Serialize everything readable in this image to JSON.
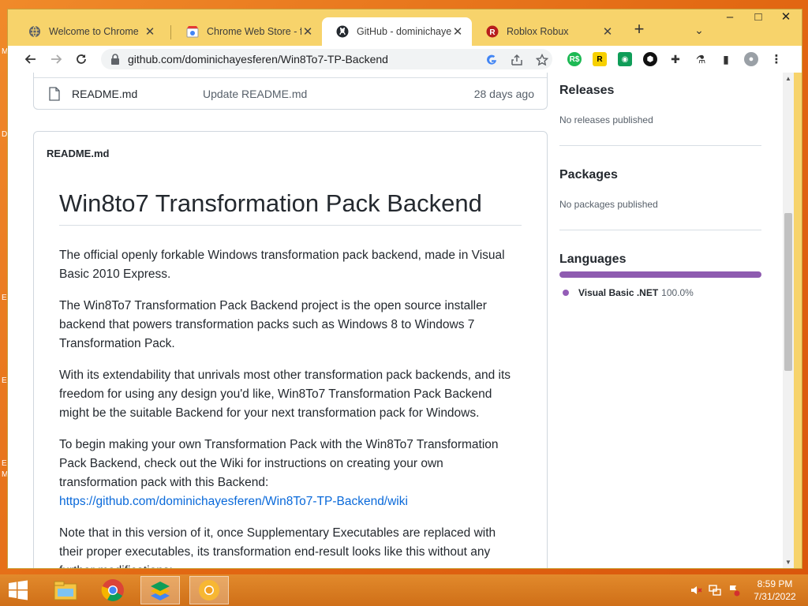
{
  "desktop": {
    "edge_letters": [
      "M",
      "D",
      "E",
      "E",
      "E",
      "M"
    ]
  },
  "tabs": [
    {
      "title": "Welcome to Chrome",
      "icon": "chrome-globe-icon"
    },
    {
      "title": "Chrome Web Store - fre",
      "icon": "webstore-icon"
    },
    {
      "title": "GitHub - dominichayesf",
      "icon": "github-icon",
      "active": true
    },
    {
      "title": "Roblox Robux",
      "icon": "roblox-icon"
    }
  ],
  "tabstrip": {
    "new_tab": "+",
    "tab_search": "⌄"
  },
  "window_controls": {
    "minimize": "–",
    "maximize": "□",
    "close": "✕"
  },
  "address_bar": {
    "url": "github.com/dominichayesferen/Win8To7-TP-Backend"
  },
  "file_list": {
    "row": {
      "name": "README.md",
      "message": "Update README.md",
      "age": "28 days ago"
    }
  },
  "readme": {
    "header": "README.md",
    "title": "Win8to7 Transformation Pack Backend",
    "paragraphs": [
      "The official openly forkable Windows transformation pack backend, made in Visual Basic 2010 Express.",
      "The Win8To7 Transformation Pack Backend project is the open source installer backend that powers transformation packs such as Windows 8 to Windows 7 Transformation Pack.",
      "With its extendability that unrivals most other transformation pack backends, and its freedom for using any design you'd like, Win8To7 Transformation Pack Backend might be the suitable Backend for your next transformation pack for Windows.",
      "To begin making your own Transformation Pack with the Win8To7 Transformation Pack Backend, check out the Wiki for instructions on creating your own transformation pack with this Backend:"
    ],
    "wiki_link": "https://github.com/dominichayesferen/Win8To7-TP-Backend/wiki",
    "last_paragraph": "Note that in this version of it, once Supplementary Executables are replaced with their proper executables, its transformation end-result looks like this without any further modifications:"
  },
  "sidebar": {
    "releases": {
      "title": "Releases",
      "text": "No releases published"
    },
    "packages": {
      "title": "Packages",
      "text": "No packages published"
    },
    "languages": {
      "title": "Languages",
      "items": [
        {
          "name": "Visual Basic .NET",
          "percent": "100.0%",
          "fraction": 1.0,
          "color": "#945db7"
        }
      ]
    }
  },
  "taskbar": {
    "clock_time": "8:59 PM",
    "clock_date": "7/31/2022",
    "apps": [
      "start-icon",
      "file-explorer-icon",
      "chrome-icon",
      "bluestacks-icon",
      "chrome-canary-icon"
    ]
  }
}
